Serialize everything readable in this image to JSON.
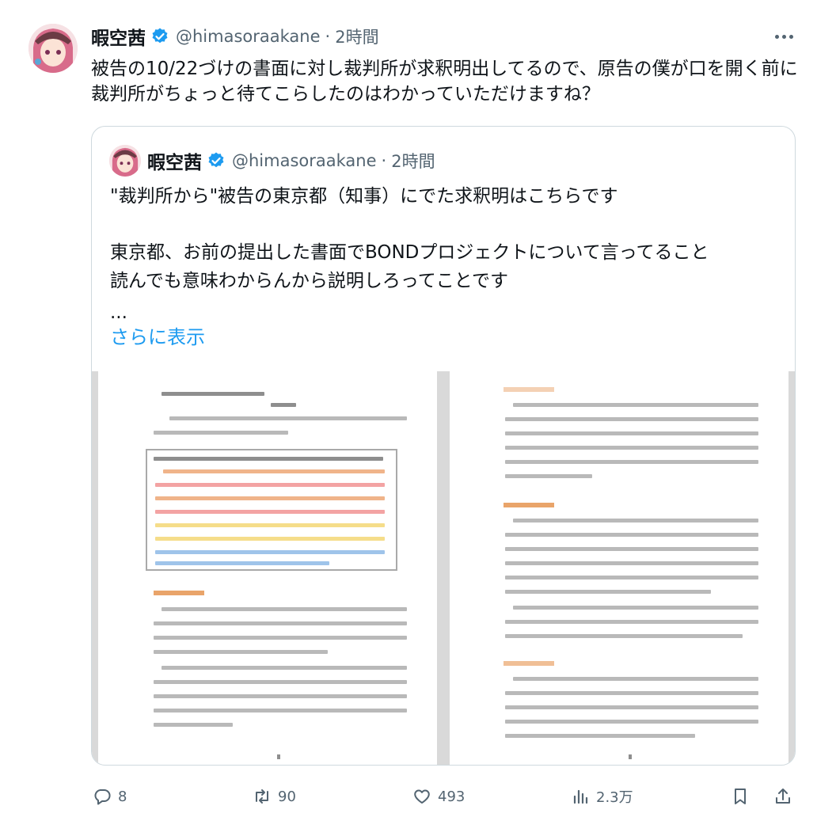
{
  "post": {
    "author_name": "暇空茜",
    "handle": "@himasoraakane",
    "separator": "·",
    "time": "2時間",
    "text": "被告の10/22づけの書面に対し裁判所が求釈明出してるので、原告の僕が口を開く前に裁判所がちょっと待てこらしたのはわかっていただけますね？"
  },
  "quote": {
    "author_name": "暇空茜",
    "handle": "@himasoraakane",
    "separator": "·",
    "time": "2時間",
    "line1": "\"裁判所から\"被告の東京都（知事）にでた求釈明はこちらです",
    "line2": "東京都、お前の提出した書面でBONDプロジェクトについて言ってること",
    "line3": "読んでも意味わからんから説明しろってことです",
    "ellipsis": "...",
    "show_more": "さらに表示"
  },
  "actions": {
    "replies": "8",
    "reposts": "90",
    "likes": "493",
    "views": "2.3万"
  },
  "colors": {
    "accent": "#1d9bf0",
    "secondary_text": "#536471",
    "border": "#cfd9de"
  },
  "icons": [
    "verified-badge-icon",
    "more-dots-icon",
    "reply-icon",
    "repost-icon",
    "like-icon",
    "views-icon",
    "bookmark-icon",
    "share-icon"
  ]
}
